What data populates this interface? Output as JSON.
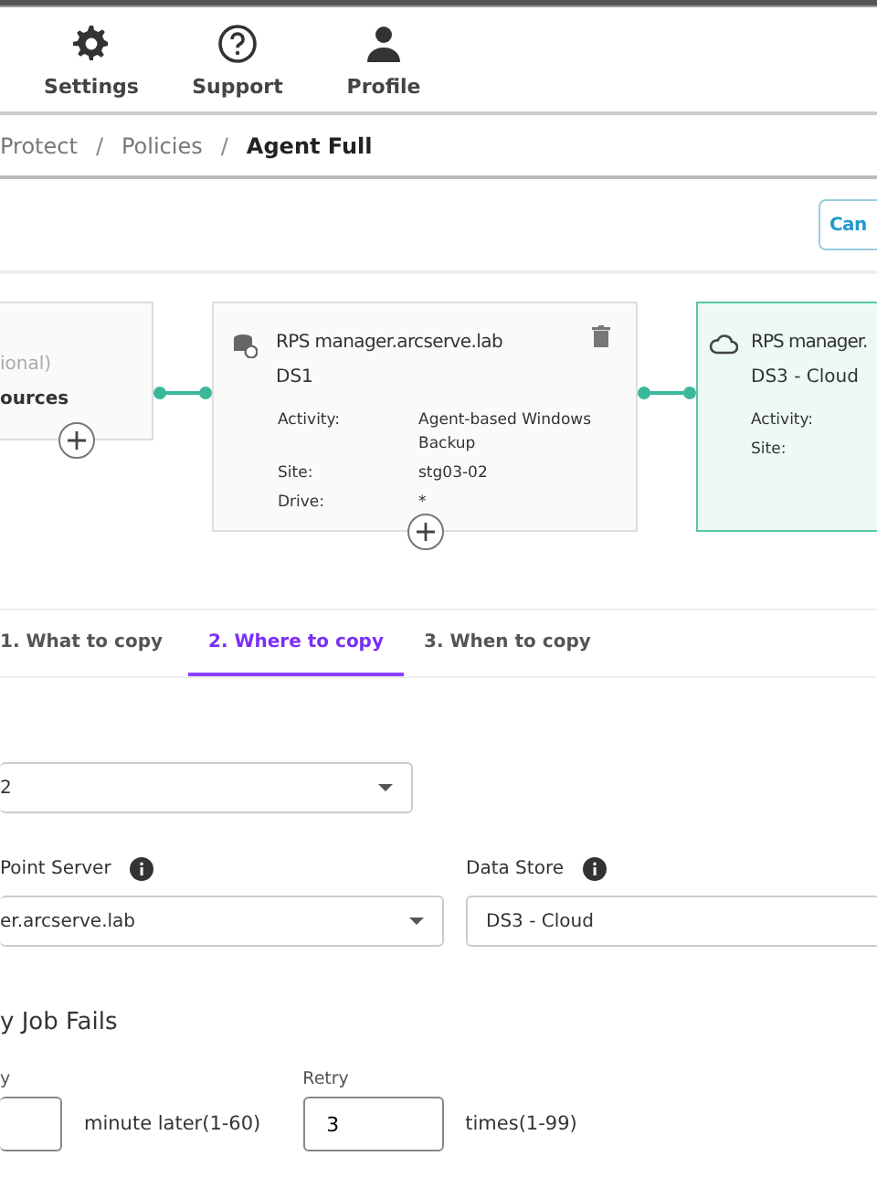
{
  "nav": [
    {
      "kind": "gear",
      "label": "Settings"
    },
    {
      "kind": "help",
      "label": "Support"
    },
    {
      "kind": "person",
      "label": "Profile"
    }
  ],
  "breadcrumb": [
    {
      "label": "Protect",
      "current": false
    },
    {
      "label": "Policies",
      "current": false
    },
    {
      "label": "Agent Full",
      "current": true
    }
  ],
  "breadcrumb_separator": "/",
  "cancel_button": "Can",
  "cards": [
    {
      "kind": "source",
      "subtitle": "ional)",
      "title": "ources",
      "selected": false
    },
    {
      "kind": "server",
      "title": "RPS manager.arcserve.lab",
      "subtitle": "DS1",
      "selected": false,
      "deletable": true,
      "details": [
        {
          "label": "Activity:",
          "value": "Agent-based Windows Backup"
        },
        {
          "label": "Site:",
          "value": "stg03-02"
        },
        {
          "label": "Drive:",
          "value": "*"
        }
      ]
    },
    {
      "kind": "cloud",
      "title": "RPS manager.",
      "subtitle": "DS3 - Cloud",
      "selected": true,
      "details": [
        {
          "label": "Activity:"
        },
        {
          "label": "Site:"
        }
      ]
    }
  ],
  "tabs": [
    {
      "label": "1. What to copy",
      "selected": false
    },
    {
      "label": "2. Where to copy",
      "selected": true
    },
    {
      "label": "3. When to copy",
      "selected": false
    }
  ],
  "site_field": {
    "value": "2"
  },
  "server_field": {
    "label": "Point Server",
    "value": "er.arcserve.lab"
  },
  "datastore_field": {
    "label": "Data Store",
    "value": "DS3 - Cloud"
  },
  "section_title": "y Job Fails",
  "retry_after": {
    "label": "y",
    "suffix": "minute later(1-60)"
  },
  "retry_times": {
    "label": "Retry",
    "value": "3",
    "suffix": "times(1-99)"
  }
}
